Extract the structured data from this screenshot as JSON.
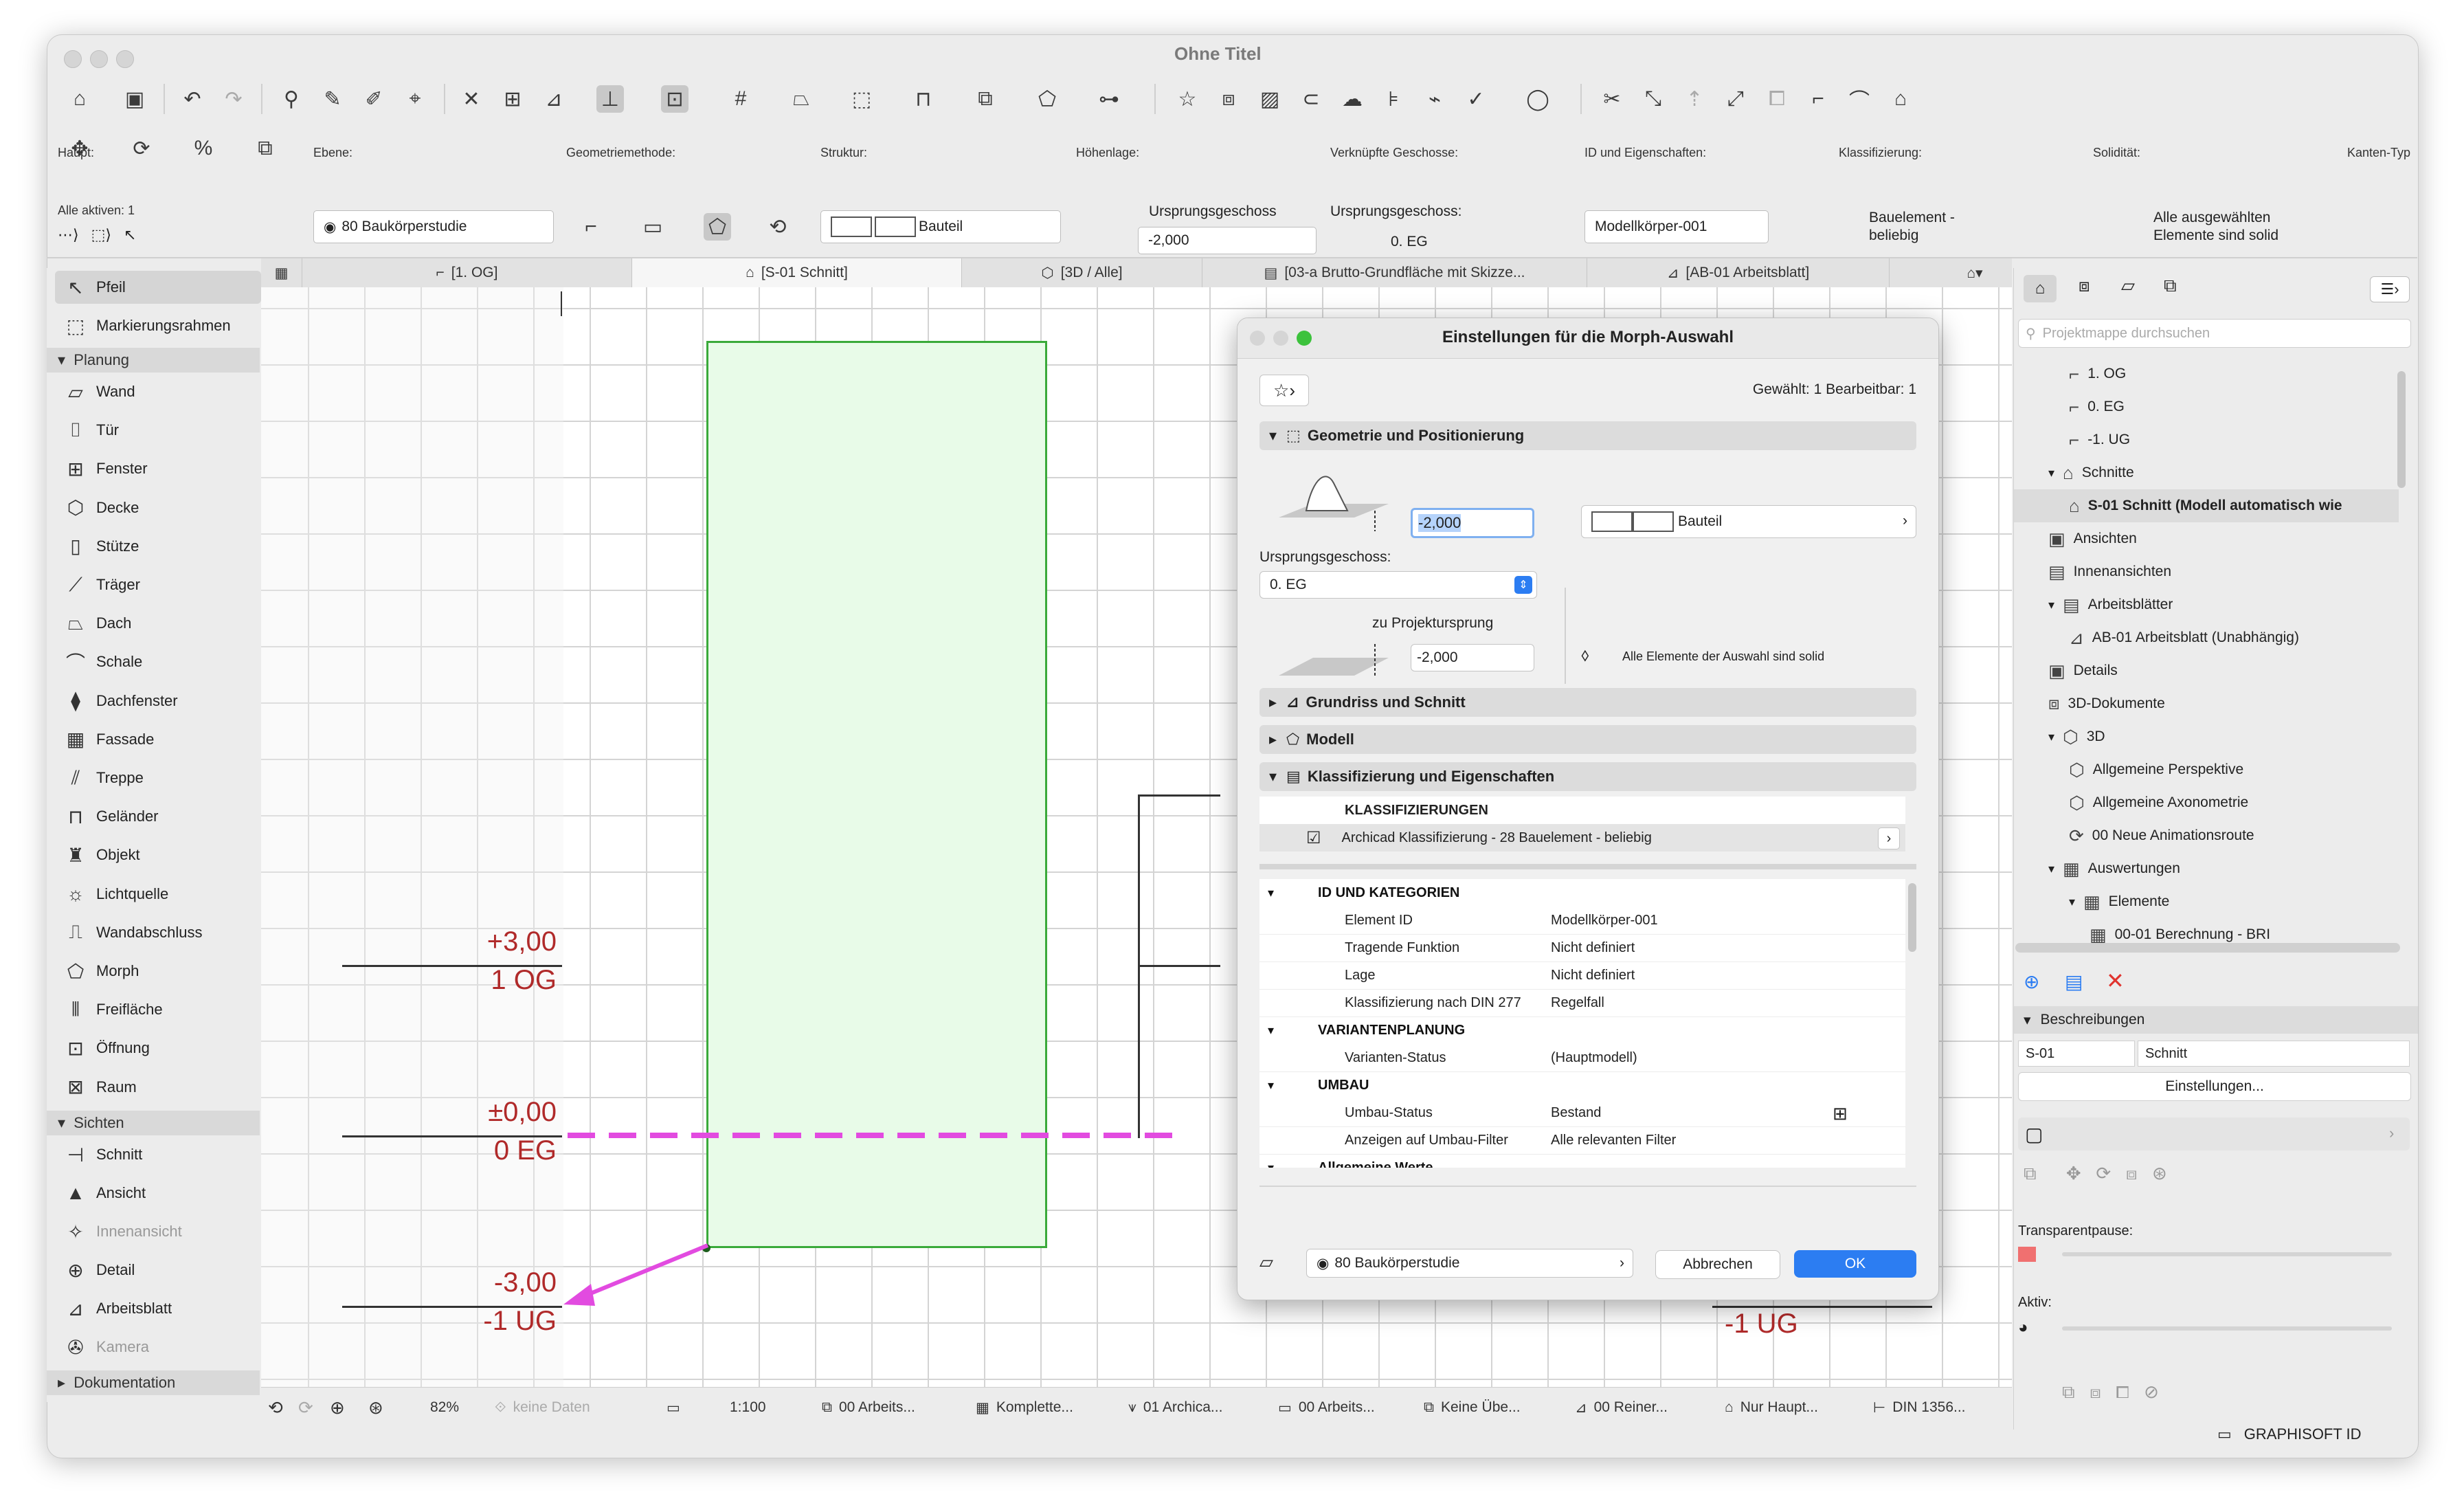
{
  "window": {
    "title": "Ohne Titel"
  },
  "infobox": {
    "haupt_label": "Haupt:",
    "alle_aktiven": "Alle aktiven: 1",
    "ebene_label": "Ebene:",
    "ebene_value": "80 Baukörperstudie",
    "geometrie_label": "Geometriemethode:",
    "struktur_label": "Struktur:",
    "struktur_value": "Bauteil",
    "hoehenlage_label": "Höhenlage:",
    "ursprung_label": "Ursprungsgeschoss",
    "hoehe_value": "-2,000",
    "geschosse_label": "Verknüpfte Geschosse:",
    "geschosse_sub": "Ursprungsgeschoss:",
    "geschosse_value": "0. EG",
    "id_label": "ID und Eigenschaften:",
    "id_value": "Modellkörper-001",
    "klass_label": "Klassifizierung:",
    "klass_value_1": "Bauelement -",
    "klass_value_2": "beliebig",
    "solid_label": "Solidität:",
    "solid_value_1": "Alle ausgewählten",
    "solid_value_2": "Elemente sind solid",
    "kanten_label": "Kanten-Typ"
  },
  "tabs": [
    {
      "label": "[1. OG]"
    },
    {
      "label": "[S-01 Schnitt]"
    },
    {
      "label": "[3D / Alle]"
    },
    {
      "label": "[03-a Brutto-Grundfläche mit Skizze..."
    },
    {
      "label": "[AB-01 Arbeitsblatt]"
    }
  ],
  "toolbox": {
    "pfeil": "Pfeil",
    "marquee": "Markierungsrahmen",
    "planung": "Planung",
    "planung_tools": [
      "Wand",
      "Tür",
      "Fenster",
      "Decke",
      "Stütze",
      "Träger",
      "Dach",
      "Schale",
      "Dachfenster",
      "Fassade",
      "Treppe",
      "Geländer",
      "Objekt",
      "Lichtquelle",
      "Wandabschluss",
      "Morph",
      "Freifläche",
      "Öffnung",
      "Raum"
    ],
    "sichten": "Sichten",
    "sichten_tools": [
      "Schnitt",
      "Ansicht",
      "Innenansicht",
      "Detail",
      "Arbeitsblatt",
      "Kamera"
    ],
    "dokumentation": "Dokumentation"
  },
  "levels": {
    "og_value": "+3,00",
    "og_name": "1 OG",
    "eg_value": "±0,00",
    "eg_name": "0 EG",
    "ug_value": "-3,00",
    "ug_name": "-1 UG",
    "ug_right": "-1 UG"
  },
  "statusbar": {
    "zoom": "82%",
    "keine_daten": "keine Daten",
    "scale": "1:100",
    "arbeits1": "00 Arbeits...",
    "komplette": "Komplette...",
    "archica": "01 Archica...",
    "arbeits2": "00 Arbeits...",
    "keine_ube": "Keine Übe...",
    "reiner": "00 Reiner...",
    "nur_haupt": "Nur Haupt...",
    "din": "DIN 1356..."
  },
  "navigator": {
    "search_placeholder": "Projektmappe durchsuchen",
    "items": [
      "1. OG",
      "0. EG",
      "-1. UG",
      "Schnitte",
      "S-01 Schnitt (Modell automatisch wie",
      "Ansichten",
      "Innenansichten",
      "Arbeitsblätter",
      "AB-01 Arbeitsblatt (Unabhängig)",
      "Details",
      "3D-Dokumente",
      "3D",
      "Allgemeine Perspektive",
      "Allgemeine Axonometrie",
      "00 Neue Animationsroute",
      "Auswertungen",
      "Elemente",
      "00-01 Berechnung - BRI"
    ],
    "beschreibungen": "Beschreibungen",
    "view_id": "S-01",
    "view_name": "Schnitt",
    "einstellungen": "Einstellungen...",
    "transparent_label": "Transparentpause:",
    "aktiv_label": "Aktiv:",
    "graphisoft": "GRAPHISOFT ID"
  },
  "dialog": {
    "title": "Einstellungen für die Morph-Auswahl",
    "selected_info": "Gewählt: 1 Bearbeitbar: 1",
    "sec_geometrie": "Geometrie und Positionierung",
    "height_value": "-2,000",
    "struktur_value": "Bauteil",
    "ursprung_label": "Ursprungsgeschoss:",
    "ursprung_value": "0. EG",
    "projekt_label": "zu Projektursprung",
    "projekt_value": "-2,000",
    "solid_note": "Alle Elemente der Auswahl sind solid",
    "sec_grundriss": "Grundriss und Schnitt",
    "sec_modell": "Modell",
    "sec_klass": "Klassifizierung und Eigenschaften",
    "klass_header": "KLASSIFIZIERUNGEN",
    "klass_row": "Archicad Klassifizierung - 28 Bauelement - beliebig",
    "props": [
      {
        "group": "ID UND KATEGORIEN"
      },
      {
        "k": "Element ID",
        "v": "Modellkörper-001"
      },
      {
        "k": "Tragende Funktion",
        "v": "Nicht definiert"
      },
      {
        "k": "Lage",
        "v": "Nicht definiert"
      },
      {
        "k": "Klassifizierung nach DIN 277",
        "v": "Regelfall"
      },
      {
        "group": "VARIANTENPLANUNG"
      },
      {
        "k": "Varianten-Status",
        "v": "(Hauptmodell)"
      },
      {
        "group": "UMBAU"
      },
      {
        "k": "Umbau-Status",
        "v": "Bestand"
      },
      {
        "k": "Anzeigen auf Umbau-Filter",
        "v": "Alle relevanten Filter"
      },
      {
        "group": "Allgemeine Werte"
      }
    ],
    "layer_value": "80 Baukörperstudie",
    "cancel": "Abbrechen",
    "ok": "OK"
  },
  "colors": {
    "morph_fill": "#e8fbe8",
    "morph_stroke": "#3aaa3a",
    "magenta": "#e24be0",
    "level_red": "#b02a2a",
    "accent_blue": "#2c7df2"
  }
}
